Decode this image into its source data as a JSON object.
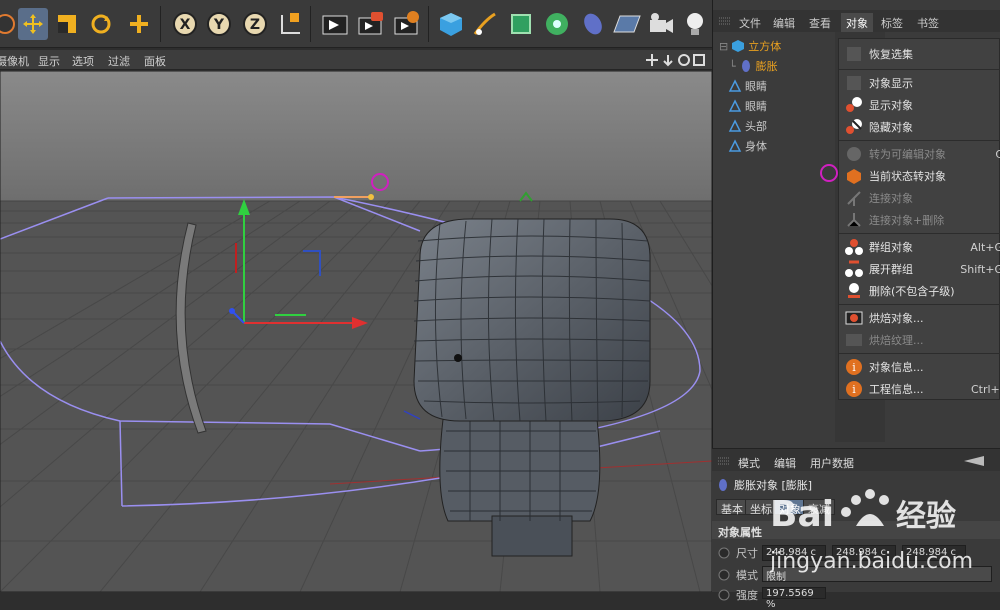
{
  "toolbar": {
    "buttons": [
      "scale-tool",
      "move-tool",
      "scale-box-tool",
      "rotate-tool",
      "add-tool",
      "x-axis-lock",
      "y-axis-lock",
      "z-axis-lock",
      "world-coord",
      "render-view",
      "render-picture",
      "render-settings",
      "cube-primitive",
      "pen-tool",
      "subdivision",
      "array-mograph",
      "deformer",
      "floor-env",
      "camera",
      "light"
    ],
    "axis": {
      "x": "X",
      "y": "Y",
      "z": "Z"
    }
  },
  "viewport_menu": [
    "摄像机",
    "显示",
    "选项",
    "过滤",
    "面板"
  ],
  "viewport_status": "",
  "right_menu": {
    "items": [
      "文件",
      "编辑",
      "查看",
      "对象",
      "标签",
      "书签"
    ],
    "active": "对象"
  },
  "objects": [
    {
      "name": "立方体",
      "type": "cube",
      "color": "#e8a020",
      "indent": 0
    },
    {
      "name": "膨胀",
      "type": "deformer",
      "color": "#e8a020",
      "indent": 1
    },
    {
      "name": "眼睛",
      "type": "null",
      "color": "#d0d0d0",
      "indent": 0
    },
    {
      "name": "眼睛",
      "type": "null",
      "color": "#d0d0d0",
      "indent": 0
    },
    {
      "name": "头部",
      "type": "null",
      "color": "#d0d0d0",
      "indent": 0
    },
    {
      "name": "身体",
      "type": "null",
      "color": "#d0d0d0",
      "indent": 0
    }
  ],
  "context_menu": {
    "items": [
      {
        "label": "恢复选集",
        "shortcut": "",
        "disabled": false,
        "icon": "restore-selection-icon"
      },
      {
        "label": "对象显示",
        "shortcut": "",
        "disabled": false,
        "icon": "none"
      },
      {
        "label": "显示对象",
        "shortcut": "",
        "disabled": false,
        "icon": "show-object-icon"
      },
      {
        "label": "隐藏对象",
        "shortcut": "",
        "disabled": false,
        "icon": "hide-object-icon"
      },
      {
        "label": "转为可编辑对象",
        "shortcut": "C",
        "disabled": true,
        "icon": "make-editable-icon"
      },
      {
        "label": "当前状态转对象",
        "shortcut": "",
        "disabled": false,
        "icon": "current-state-icon"
      },
      {
        "label": "连接对象",
        "shortcut": "",
        "disabled": true,
        "icon": "connect-icon"
      },
      {
        "label": "连接对象+删除",
        "shortcut": "",
        "disabled": true,
        "icon": "connect-delete-icon"
      },
      {
        "label": "群组对象",
        "shortcut": "Alt+G",
        "disabled": false,
        "icon": "group-icon"
      },
      {
        "label": "展开群组",
        "shortcut": "Shift+G",
        "disabled": false,
        "icon": "ungroup-icon"
      },
      {
        "label": "删除(不包含子级)",
        "shortcut": "",
        "disabled": false,
        "icon": "delete-icon"
      },
      {
        "label": "烘焙对象...",
        "shortcut": "",
        "disabled": false,
        "icon": "bake-object-icon"
      },
      {
        "label": "烘焙纹理...",
        "shortcut": "",
        "disabled": true,
        "icon": "bake-texture-icon"
      },
      {
        "label": "对象信息...",
        "shortcut": "",
        "disabled": false,
        "icon": "object-info-icon"
      },
      {
        "label": "工程信息...",
        "shortcut": "Ctrl+I",
        "disabled": false,
        "icon": "project-info-icon"
      }
    ]
  },
  "attributes": {
    "menu": [
      "模式",
      "编辑",
      "用户数据"
    ],
    "title": "膨胀对象 [膨胀]",
    "tabs": [
      "基本",
      "坐标",
      "对象",
      "衰减"
    ],
    "active_tab": "对象",
    "section": "对象属性",
    "size_label": "尺寸",
    "size_values": [
      "248.984 c",
      "248.984 c",
      "248.984 c"
    ],
    "mode_label": "模式",
    "mode_value": "限制",
    "strength_label": "强度",
    "strength_value": "197.5569 %"
  },
  "watermark": {
    "brand": "Bai",
    "brand2": "经验",
    "url": "jingyan.baidu.com"
  },
  "colors": {
    "accent": "#5e7592",
    "highlight": "#e8a020",
    "selection_ring": "#d020c0"
  }
}
